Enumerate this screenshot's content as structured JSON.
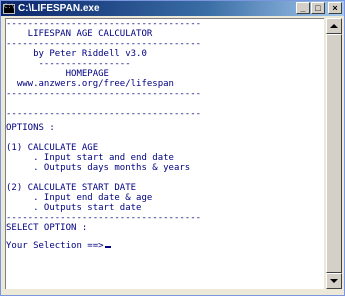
{
  "window": {
    "title": "C:\\LIFESPAN.exe",
    "buttons": {
      "minimize": "_",
      "maximize": "□",
      "close": "×"
    }
  },
  "console": {
    "lines": [
      "------------------------------------",
      "    LIFESPAN AGE CALCULATOR",
      "------------------------------------",
      "     by Peter Riddell v3.0",
      "      -----------------",
      "           HOMEPAGE",
      "  www.anzwers.org/free/lifespan",
      "------------------------------------",
      "",
      "------------------------------------",
      "OPTIONS :",
      "",
      "(1) CALCULATE AGE",
      "     . Input start and end date",
      "     . Outputs days months & years",
      "",
      "(2) CALCULATE START DATE",
      "     . Input end date & age",
      "     . Outputs start date",
      "------------------------------------",
      "SELECT OPTION :",
      "",
      "Your Selection ==>"
    ]
  },
  "colors": {
    "console_text": "#000080",
    "console_background": "#ffffff",
    "titlebar_start": "#0a246a",
    "titlebar_end": "#a6caf0"
  },
  "icons": {
    "title": "console-icon",
    "scroll_up": "up-arrow-icon",
    "scroll_down": "down-arrow-icon"
  }
}
